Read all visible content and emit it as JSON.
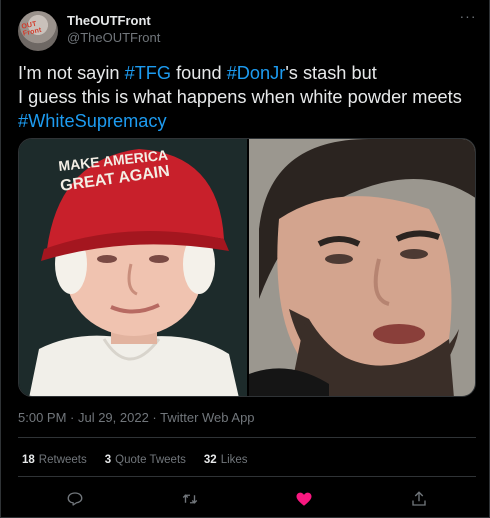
{
  "author": {
    "display_name": "TheOUTFront",
    "handle": "@TheOUTFront",
    "avatar_text": "OUT Front"
  },
  "tweet": {
    "line1_pre": "I'm not sayin ",
    "hashtag1": "#TFG",
    "line1_mid": " found ",
    "hashtag2": "#DonJr",
    "line1_post": "'s stash but",
    "line2": "I guess this is what happens when white powder meets",
    "hashtag3": "#WhiteSupremacy",
    "media": {
      "left_hat_text": "MAKE AMERICA GREAT AGAIN",
      "left_hat_color": "#c8202b",
      "right_background": "#9b978f"
    }
  },
  "meta": {
    "timestamp": "5:00 PM · Jul 29, 2022 · Twitter Web App"
  },
  "stats": {
    "retweets_count": "18",
    "retweets_label": "Retweets",
    "quotes_count": "3",
    "quotes_label": "Quote Tweets",
    "likes_count": "32",
    "likes_label": "Likes"
  },
  "actions": [
    {
      "icon": "reply-icon"
    },
    {
      "icon": "retweet-icon"
    },
    {
      "icon": "heart-icon",
      "active": true,
      "color": "#f91880"
    },
    {
      "icon": "share-icon"
    }
  ],
  "colors": {
    "background": "#000000",
    "text": "#e7e9ea",
    "secondary": "#71767b",
    "accent": "#1d9bf0",
    "like": "#f91880"
  }
}
